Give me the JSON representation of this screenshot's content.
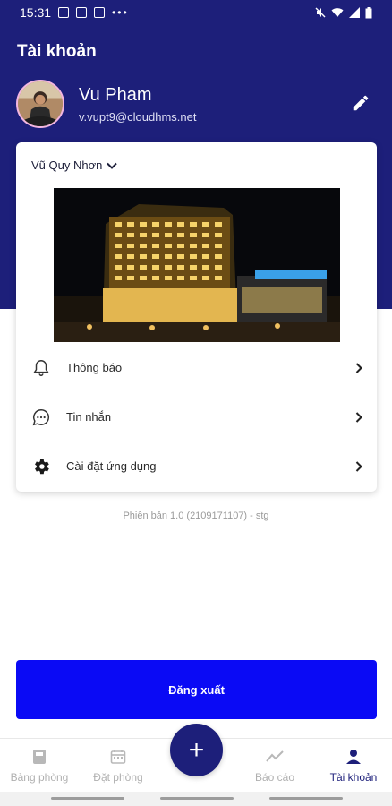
{
  "status_bar": {
    "time": "15:31",
    "dots": "•••"
  },
  "header": {
    "title": "Tài khoản"
  },
  "user": {
    "name": "Vu Pham",
    "email": "v.vupt9@cloudhms.net"
  },
  "hotel": {
    "selected": "Vũ Quy Nhơn"
  },
  "menu": [
    {
      "label": "Thông báo",
      "icon": "bell-icon"
    },
    {
      "label": "Tin nhắn",
      "icon": "chat-icon"
    },
    {
      "label": "Cài đặt ứng dụng",
      "icon": "gear-icon"
    }
  ],
  "version": "Phiên bản 1.0 (2109171107) - stg",
  "logout": {
    "label": "Đăng xuất"
  },
  "nav": [
    {
      "label": "Bảng phòng",
      "icon": "room-board-icon",
      "active": false
    },
    {
      "label": "Đặt phòng",
      "icon": "calendar-icon",
      "active": false
    },
    {
      "label": "Báo cáo",
      "icon": "chart-icon",
      "active": false
    },
    {
      "label": "Tài khoản",
      "icon": "person-icon",
      "active": true
    }
  ],
  "fab": {
    "label": "+"
  },
  "colors": {
    "primary": "#1d1f7a",
    "button": "#0a0af5",
    "inactive": "#b0b0b0"
  }
}
